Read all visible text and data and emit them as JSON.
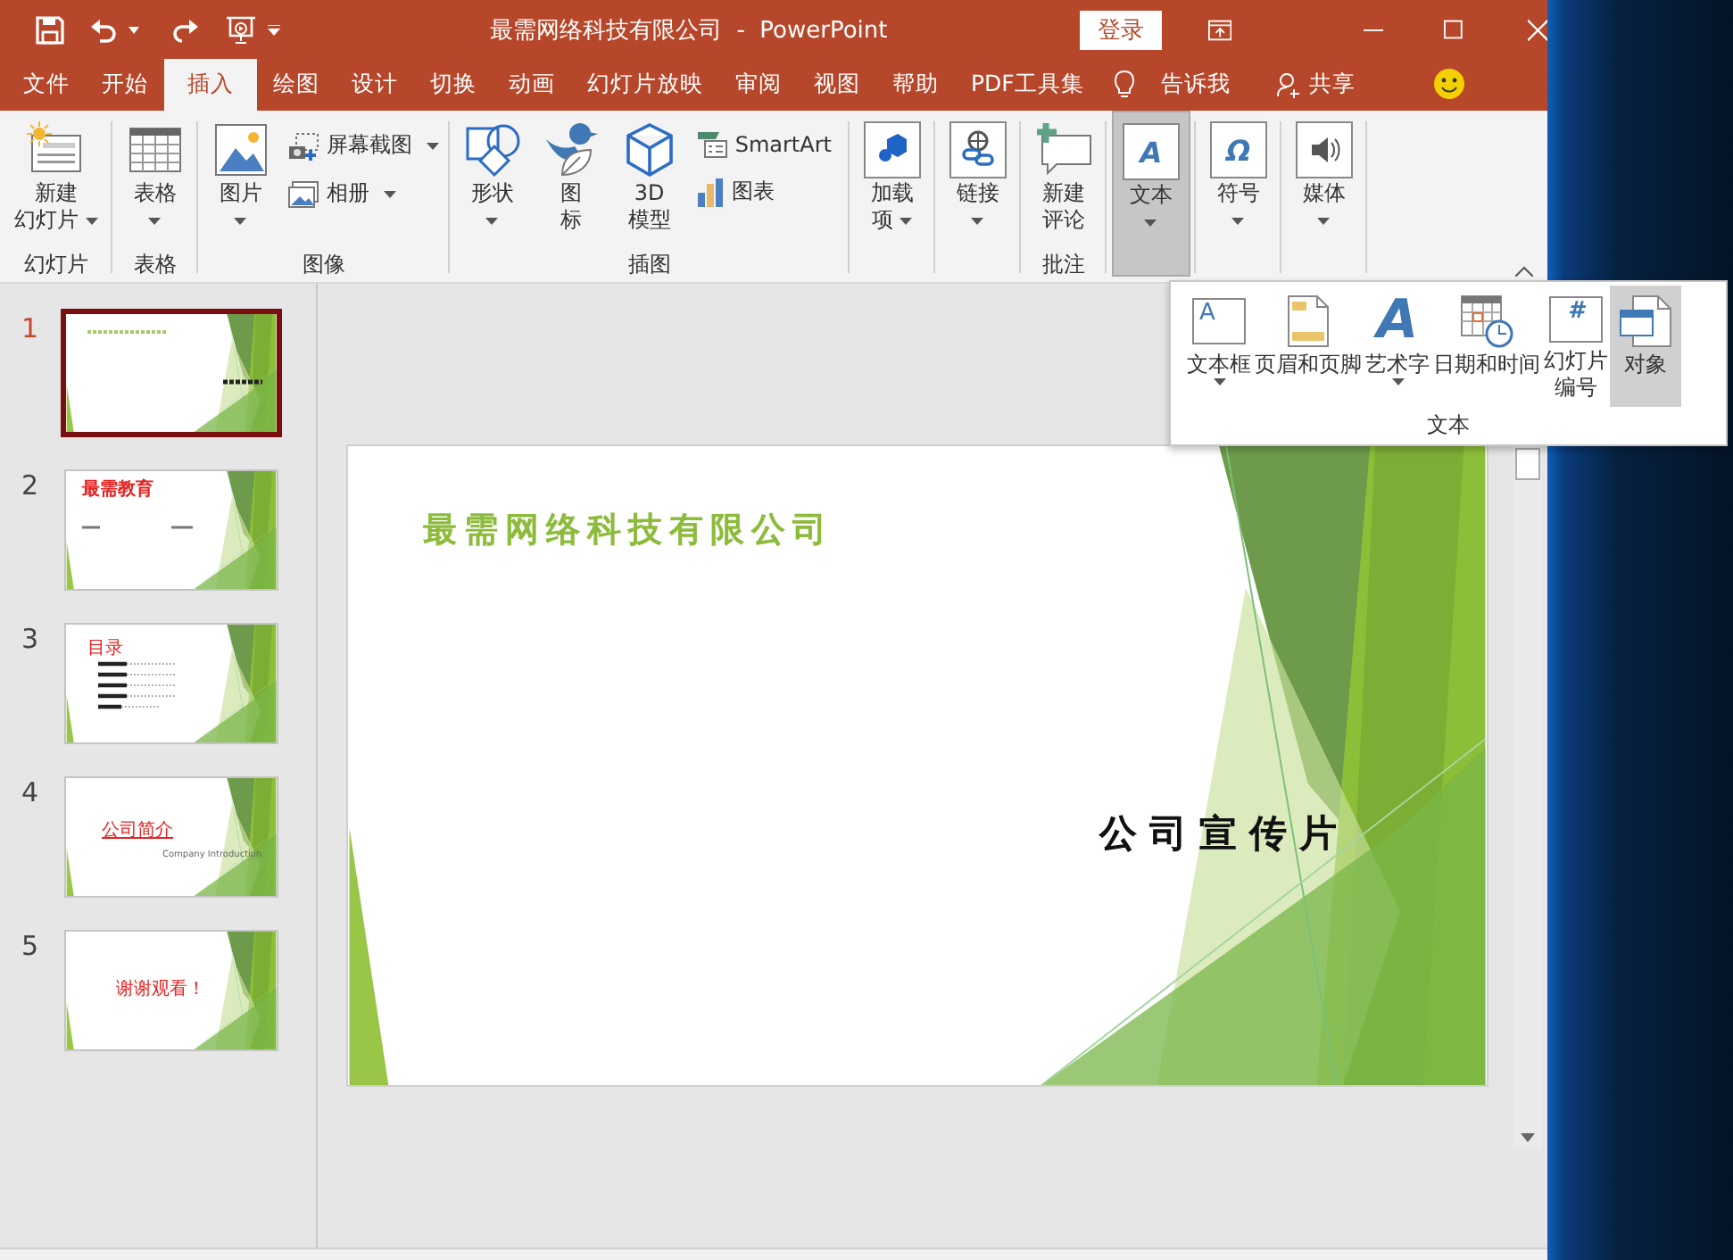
{
  "title_bar": {
    "title": "最需网络科技有限公司  -  PowerPoint",
    "login_button": "登录"
  },
  "tabs": [
    {
      "label": "文件",
      "selected": false
    },
    {
      "label": "开始",
      "selected": false
    },
    {
      "label": "插入",
      "selected": true
    },
    {
      "label": "绘图",
      "selected": false
    },
    {
      "label": "设计",
      "selected": false
    },
    {
      "label": "切换",
      "selected": false
    },
    {
      "label": "动画",
      "selected": false
    },
    {
      "label": "幻灯片放映",
      "selected": false
    },
    {
      "label": "审阅",
      "selected": false
    },
    {
      "label": "视图",
      "selected": false
    },
    {
      "label": "帮助",
      "selected": false
    },
    {
      "label": "PDF工具集",
      "selected": false
    }
  ],
  "tell_me": "告诉我",
  "share": "共享",
  "ribbon_groups": [
    {
      "label": "幻灯片",
      "items": [
        {
          "kind": "large",
          "label": [
            "新建",
            "幻灯片"
          ],
          "dropdown": true,
          "pressed": false
        }
      ]
    },
    {
      "label": "表格",
      "items": [
        {
          "kind": "large",
          "label": [
            "表格"
          ],
          "dropdown": true,
          "pressed": false
        }
      ]
    },
    {
      "label": "图像",
      "items": [
        {
          "kind": "large",
          "label": [
            "图片"
          ],
          "dropdown": true,
          "pressed": false
        },
        {
          "kind": "small",
          "label": [
            "屏幕截图"
          ],
          "dropdown": true,
          "pressed": false
        },
        {
          "kind": "small",
          "label": [
            "相册"
          ],
          "dropdown": true,
          "pressed": false
        }
      ]
    },
    {
      "label": "插图",
      "items": [
        {
          "kind": "large",
          "label": [
            "形状"
          ],
          "dropdown": true,
          "pressed": false
        },
        {
          "kind": "large",
          "label": [
            "图",
            "标"
          ],
          "dropdown": false,
          "pressed": false
        },
        {
          "kind": "large",
          "label": [
            "3D",
            "模型"
          ],
          "dropdown": false,
          "pressed": false
        },
        {
          "kind": "small",
          "label": [
            "SmartArt"
          ],
          "dropdown": false,
          "pressed": false
        },
        {
          "kind": "small",
          "label": [
            "图表"
          ],
          "dropdown": false,
          "pressed": false
        }
      ]
    },
    {
      "items": [
        {
          "kind": "large",
          "label": [
            "加载",
            "项"
          ],
          "dropdown": true,
          "pressed": false
        }
      ]
    },
    {
      "items": [
        {
          "kind": "large",
          "label": [
            "链接"
          ],
          "dropdown": true,
          "pressed": false
        }
      ]
    },
    {
      "label": "批注",
      "items": [
        {
          "kind": "large",
          "label": [
            "新建",
            "评论"
          ],
          "dropdown": false,
          "pressed": false
        }
      ]
    },
    {
      "items": [
        {
          "kind": "large",
          "label": [
            "文本"
          ],
          "dropdown": true,
          "pressed": true,
          "glyph": "A"
        }
      ]
    },
    {
      "items": [
        {
          "kind": "large",
          "label": [
            "符号"
          ],
          "dropdown": true,
          "pressed": false,
          "glyph": "Ω"
        }
      ]
    },
    {
      "items": [
        {
          "kind": "large",
          "label": [
            "媒体"
          ],
          "dropdown": true,
          "pressed": false
        }
      ]
    }
  ],
  "text_menu": {
    "label": "文本",
    "items": [
      {
        "label": [
          "文本框"
        ],
        "dropdown": true,
        "highlighted": false,
        "glyph": "A"
      },
      {
        "label": [
          "页眉和页脚"
        ],
        "dropdown": false,
        "highlighted": false
      },
      {
        "label": [
          "艺术字"
        ],
        "dropdown": true,
        "highlighted": false,
        "glyph": "A"
      },
      {
        "label": [
          "日期和时间"
        ],
        "dropdown": false,
        "highlighted": false
      },
      {
        "label": [
          "幻灯片",
          "编号"
        ],
        "dropdown": false,
        "highlighted": false,
        "glyph": "#"
      },
      {
        "label": [
          "对象"
        ],
        "dropdown": false,
        "highlighted": true
      }
    ]
  },
  "slides": [
    {
      "number": "1",
      "selected": true,
      "kind": "title"
    },
    {
      "number": "2",
      "selected": false,
      "kind": "heading",
      "title": "最需教育"
    },
    {
      "number": "3",
      "selected": false,
      "kind": "contents",
      "title": "目录"
    },
    {
      "number": "4",
      "selected": false,
      "kind": "section",
      "title": "公司简介",
      "subtitle": "Company Introduction"
    },
    {
      "number": "5",
      "selected": false,
      "kind": "closing",
      "title": "谢谢观看！"
    }
  ],
  "current_slide": {
    "title": "最需网络科技有限公司",
    "subtitle": "公司宣传片"
  }
}
